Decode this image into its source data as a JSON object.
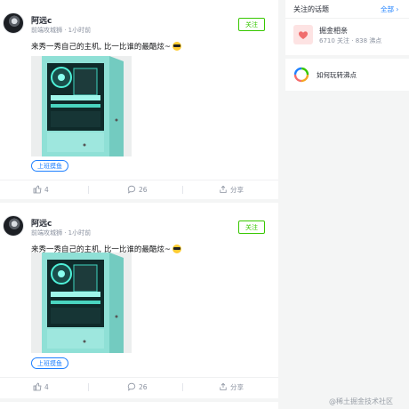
{
  "posts": [
    {
      "author": "阿远c",
      "meta": "前端攻城狮 · 1小时前",
      "follow_label": "关注",
      "content": "来秀一秀自己的主机, 比一比谁的最酷炫~",
      "tag": "上班摸鱼",
      "likes": "4",
      "comments": "26",
      "share_label": "分享"
    },
    {
      "author": "阿远c",
      "meta": "前端攻城狮 · 1小时前",
      "follow_label": "关注",
      "content": "来秀一秀自己的主机, 比一比谁的最酷炫~",
      "tag": "上班摸鱼",
      "likes": "4",
      "comments": "26",
      "share_label": "分享"
    }
  ],
  "sidebar": {
    "title": "关注的话题",
    "all_label": "全部",
    "topic": {
      "name": "掘金相亲",
      "meta": "6710 关注 · 838 沸点"
    },
    "how_label": "如何玩转沸点"
  },
  "watermark": "@稀土掘金技术社区",
  "colors": {
    "accent": "#1e80ff",
    "follow_green": "#37c700",
    "case_teal": "#8fe0d6"
  }
}
